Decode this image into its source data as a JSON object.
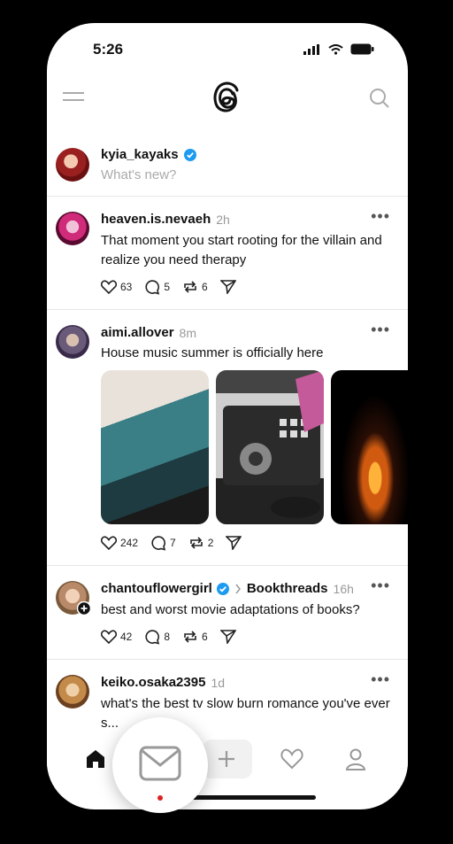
{
  "status": {
    "time": "5:26"
  },
  "compose": {
    "username": "kyia_kayaks",
    "placeholder": "What's new?"
  },
  "posts": [
    {
      "username": "heaven.is.nevaeh",
      "time": "2h",
      "text": "That moment you start rooting for the villain and realize you need therapy",
      "likes": "63",
      "replies": "5",
      "reposts": "6"
    },
    {
      "username": "aimi.allover",
      "time": "8m",
      "text": "House music summer is officially here",
      "likes": "242",
      "replies": "7",
      "reposts": "2"
    },
    {
      "username": "chantouflowergirl",
      "community": "Bookthreads",
      "time": "16h",
      "text": "best and worst movie adaptations of books?",
      "likes": "42",
      "replies": "8",
      "reposts": "6"
    },
    {
      "username": "keiko.osaka2395",
      "time": "1d",
      "text": "what's the best tv slow burn romance you've ever s..."
    }
  ],
  "colors": {
    "verified": "#1d9bf0",
    "notification_dot": "#e02020"
  }
}
